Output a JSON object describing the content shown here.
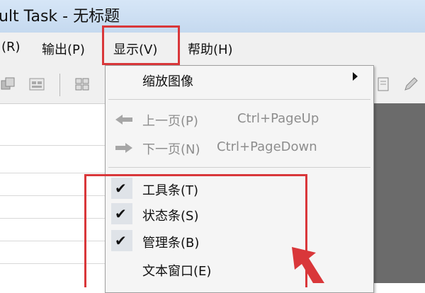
{
  "window": {
    "title": "ult Task - 无标题"
  },
  "menubar": {
    "items": [
      {
        "label": "(R)"
      },
      {
        "label": "输出(P)"
      },
      {
        "label": "显示(V)"
      },
      {
        "label": "帮助(H)"
      }
    ]
  },
  "dropdown": {
    "zoom": {
      "label": "缩放图像"
    },
    "prev_page": {
      "label": "上一页(P)",
      "shortcut": "Ctrl+PageUp"
    },
    "next_page": {
      "label": "下一页(N)",
      "shortcut": "Ctrl+PageDown"
    },
    "toolbar": {
      "label": "工具条(T)",
      "checked": true
    },
    "statusbar": {
      "label": "状态条(S)",
      "checked": true
    },
    "managebar": {
      "label": "管理条(B)",
      "checked": true
    },
    "text_window": {
      "label": "文本窗口(E)",
      "checked": false
    }
  },
  "colors": {
    "highlight": "#d9373a",
    "disabled_text": "#8d8d8d",
    "title_bar": "#d6e6f7",
    "menu_bg": "#f0f0f0",
    "dark_pane": "#6b6b6b"
  }
}
